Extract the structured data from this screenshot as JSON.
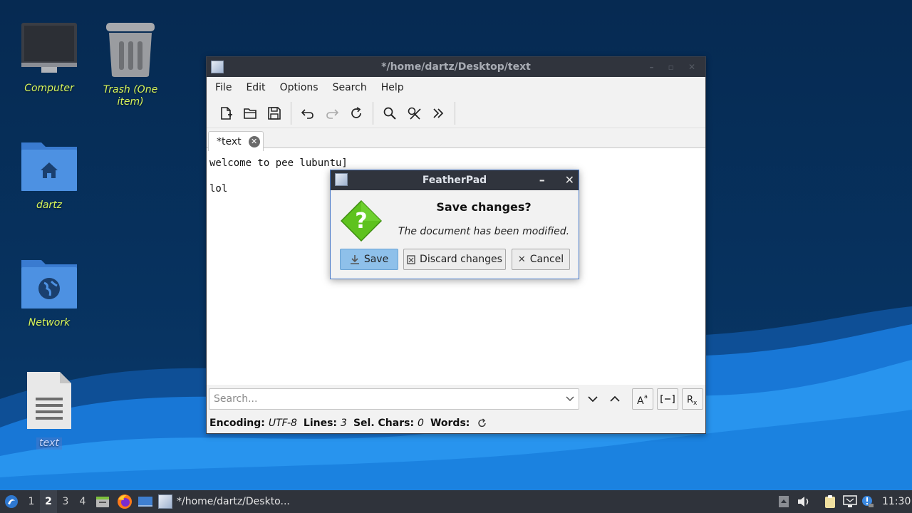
{
  "desktop": {
    "icons": [
      {
        "label": "Computer",
        "icon": "computer-icon"
      },
      {
        "label": "Trash (One item)",
        "icon": "trash-icon"
      },
      {
        "label": "dartz",
        "icon": "home-folder-icon"
      },
      {
        "label": "Network",
        "icon": "network-folder-icon"
      },
      {
        "label": "text",
        "icon": "text-file-icon"
      }
    ]
  },
  "window": {
    "title": "*/home/dartz/Desktop/text",
    "menu": [
      "File",
      "Edit",
      "Options",
      "Search",
      "Help"
    ],
    "toolbar_icons": [
      "new-file-icon",
      "open-folder-icon",
      "save-icon",
      "undo-icon",
      "redo-icon",
      "reload-icon",
      "find-icon",
      "replace-icon",
      "more-icon"
    ],
    "tab_label": "*text",
    "editor_lines": [
      "welcome to pee lubuntu]",
      "",
      "lol"
    ],
    "search_placeholder": "Search...",
    "status": {
      "encoding_label": "Encoding:",
      "encoding_value": "UTF-8",
      "lines_label": "Lines:",
      "lines_value": "3",
      "sel_label": "Sel. Chars:",
      "sel_value": "0",
      "words_label": "Words:"
    }
  },
  "dialog": {
    "title": "FeatherPad",
    "heading": "Save changes?",
    "message": "The document has been modified.",
    "save_label": "Save",
    "discard_label": "Discard changes",
    "cancel_label": "Cancel"
  },
  "taskbar": {
    "workspaces": [
      "1",
      "2",
      "3",
      "4"
    ],
    "active_workspace": "2",
    "task_label": "*/home/dartz/Deskto...",
    "clock": "11:30"
  },
  "colors": {
    "desktop_bg": "#062a52",
    "wave_light": "#1e8fe8",
    "label_yellow": "#d8f55a",
    "dialog_border": "#4a7ac8",
    "save_button": "#8ec0ea"
  }
}
